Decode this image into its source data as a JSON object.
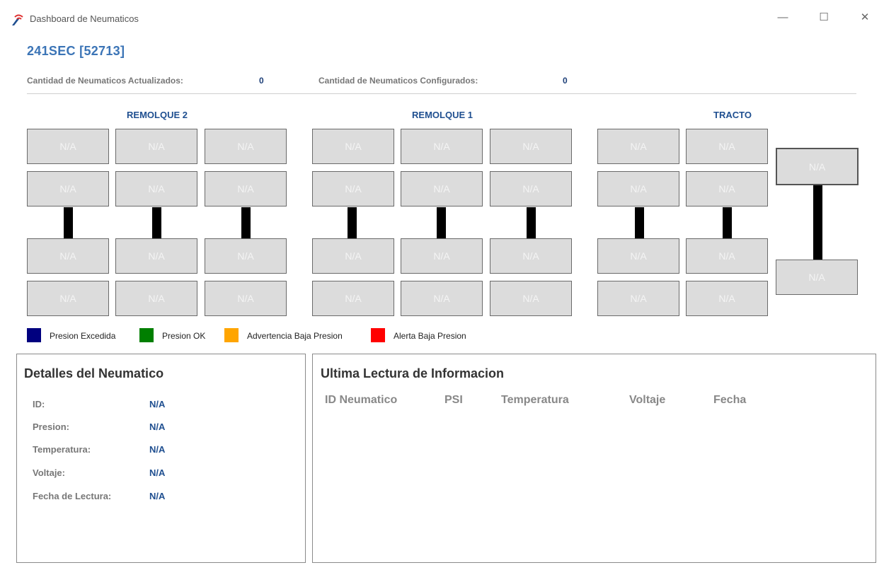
{
  "window": {
    "title": "Dashboard de Neumaticos",
    "minimize_glyph": "—",
    "maximize_glyph": "☐",
    "close_glyph": "✕"
  },
  "header": {
    "vehicle": "241SEC [52713]"
  },
  "counts": {
    "updated_label": "Cantidad de Neumaticos Actualizados:",
    "updated_value": "0",
    "configured_label": "Cantidad de Neumaticos Configurados:",
    "configured_value": "0"
  },
  "groups": {
    "remolque2": "REMOLQUE 2",
    "remolque1": "REMOLQUE 1",
    "tracto": "TRACTO"
  },
  "tire_value": "N/A",
  "legend": [
    {
      "label": "Presion Excedida",
      "color": "#00007f"
    },
    {
      "label": "Presion OK",
      "color": "#007f00"
    },
    {
      "label": "Advertencia Baja Presion",
      "color": "#ffa500"
    },
    {
      "label": "Alerta Baja Presion",
      "color": "#ff0000"
    }
  ],
  "details": {
    "title": "Detalles del Neumatico",
    "id_label": "ID:",
    "id_value": "N/A",
    "pressure_label": "Presion:",
    "pressure_value": "N/A",
    "temp_label": "Temperatura:",
    "temp_value": "N/A",
    "voltage_label": "Voltaje:",
    "voltage_value": "N/A",
    "date_label": "Fecha de Lectura:",
    "date_value": "N/A"
  },
  "last_reading": {
    "title": "Ultima Lectura de Informacion",
    "columns": [
      "ID Neumatico",
      "PSI",
      "Temperatura",
      "Voltaje",
      "Fecha"
    ]
  },
  "colors": {
    "accent": "#3b74b6",
    "value": "#1f4f90",
    "tire_bg": "#dcdcdc"
  }
}
